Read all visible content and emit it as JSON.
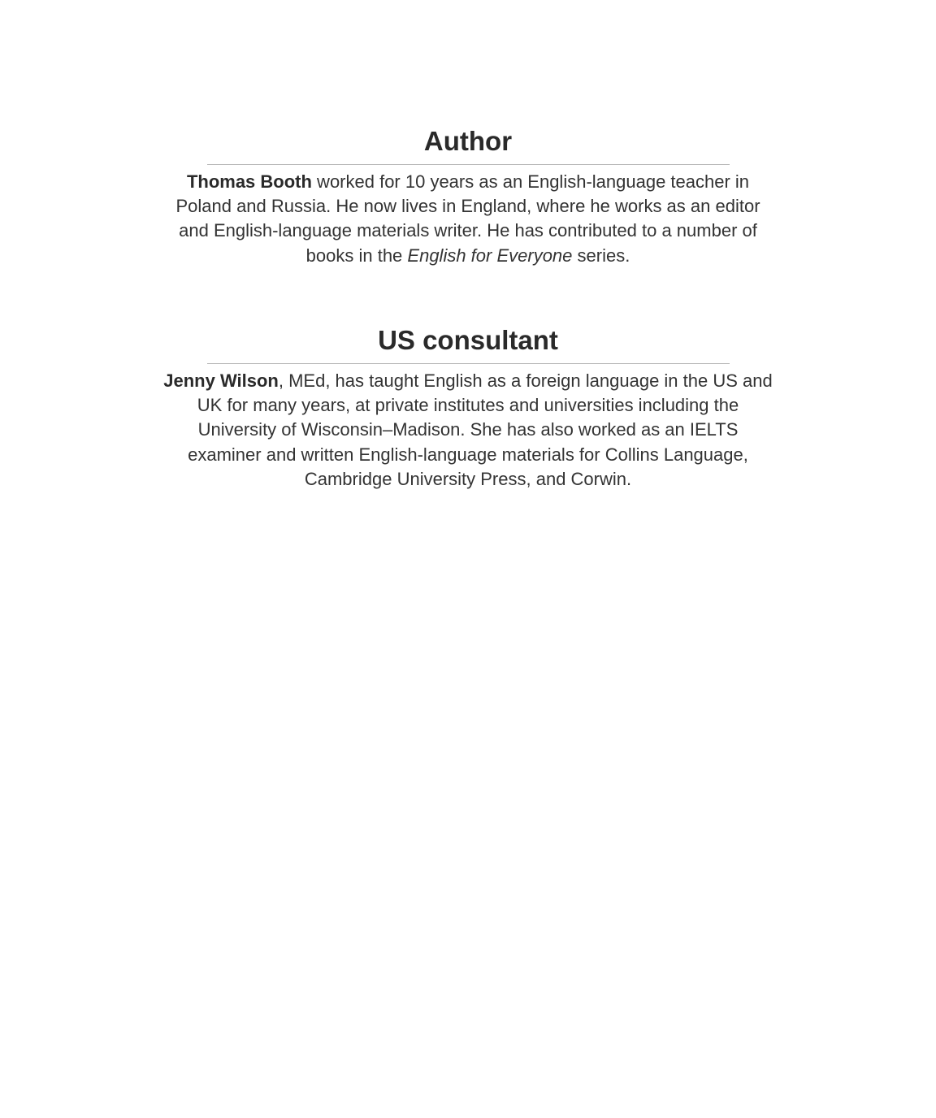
{
  "author": {
    "heading": "Author",
    "name": "Thomas Booth",
    "text_before": " worked for 10 years as an English-language teacher in Poland and Russia. He now lives in England, where he works as an editor and English-language materials writer. He has contributed to a number of books in the ",
    "series_title": "English for Everyone",
    "text_after": " series."
  },
  "consultant": {
    "heading": "US consultant",
    "name": "Jenny Wilson",
    "text": ", MEd, has taught English as a foreign language in the US and UK for many years, at private institutes and universities including the University of Wisconsin–Madison. She has also worked as an IELTS examiner and written English-language materials for Collins Language, Cambridge University Press, and Corwin."
  }
}
